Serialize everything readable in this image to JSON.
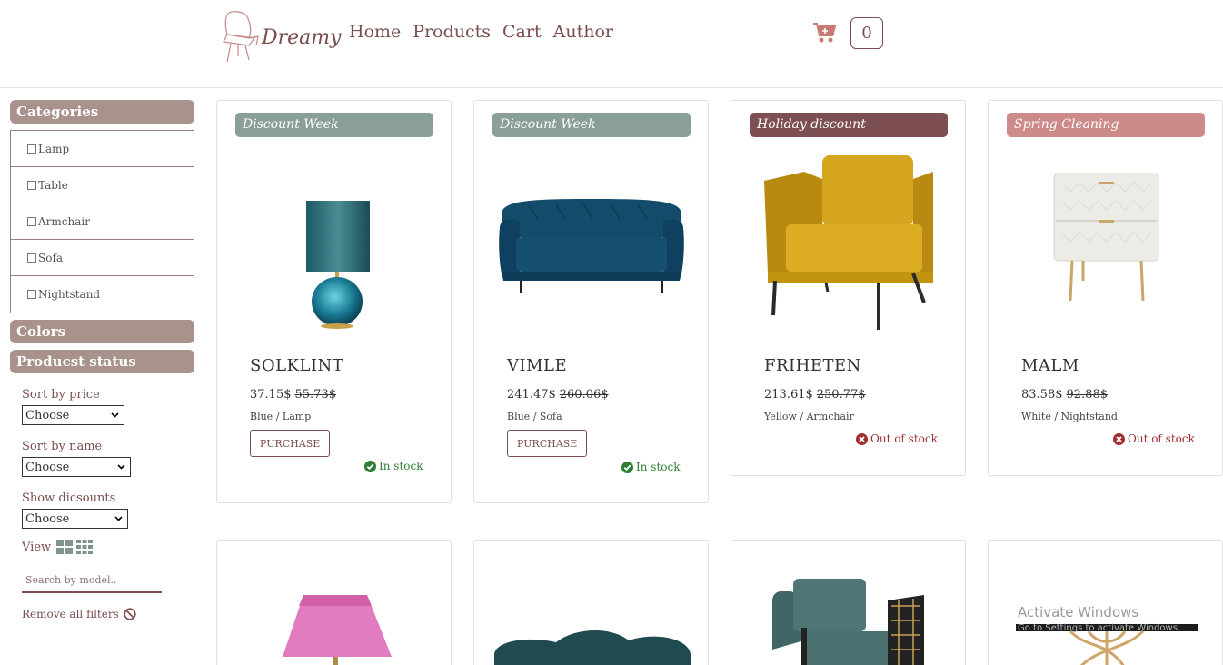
{
  "brand": {
    "name": "Dreamy"
  },
  "nav": {
    "items": [
      "Home",
      "Products",
      "Cart",
      "Author"
    ]
  },
  "cart": {
    "count": "0"
  },
  "sidebar": {
    "categories_title": "Categories",
    "categories": [
      "Lamp",
      "Table",
      "Armchair",
      "Sofa",
      "Nightstand"
    ],
    "colors_title": "Colors",
    "status_title": "Producst status",
    "sort_price_label": "Sort by price",
    "sort_price_value": "Choose",
    "sort_name_label": "Sort by name",
    "sort_name_value": "Choose",
    "discounts_label": "Show dicsounts",
    "discounts_value": "Choose",
    "view_label": "View",
    "search_placeholder": "Search by model..",
    "remove_filters": "Remove all filters"
  },
  "products": [
    {
      "badge": "Discount Week",
      "badge_color": "#8a9f97",
      "name": "SOLKLINT",
      "price": "37.15$",
      "old_price": "55.73$",
      "meta": "Blue / Lamp",
      "purchase": "PURCHASE",
      "stock": "In stock"
    },
    {
      "badge": "Discount Week",
      "badge_color": "#8a9f97",
      "name": "VIMLE",
      "price": "241.47$",
      "old_price": "260.06$",
      "meta": "Blue / Sofa",
      "purchase": "PURCHASE",
      "stock": "In stock"
    },
    {
      "badge": "Holiday discount",
      "badge_color": "#7d4e52",
      "name": "FRIHETEN",
      "price": "213.61$",
      "old_price": "250.77$",
      "meta": "Yellow / Armchair",
      "stock": "Out of stock"
    },
    {
      "badge": "Spring Cleaning",
      "badge_color": "#cc8a88",
      "name": "MALM",
      "price": "83.58$",
      "old_price": "92.88$",
      "meta": "White / Nightstand",
      "stock": "Out of stock"
    }
  ],
  "system": {
    "watermark_title": "Activate Windows",
    "watermark_sub": "Go to Settings to activate Windows."
  },
  "colors": {
    "accent": "#7a4e4e",
    "section": "#a9928b",
    "in_stock": "#2e7d32",
    "out_stock": "#a02f2f"
  }
}
